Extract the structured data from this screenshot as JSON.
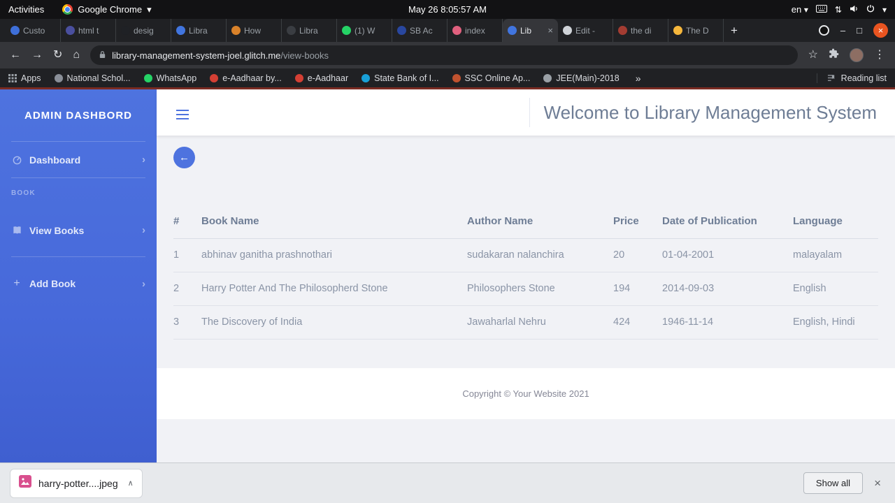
{
  "system_bar": {
    "activities_label": "Activities",
    "app_name": "Google Chrome",
    "clock": "May 26  8:05:57 AM",
    "language": "en"
  },
  "icons": {
    "caret_down": "▾",
    "caret_up": "∧",
    "back_arrow": "←",
    "forward_arrow": "→",
    "refresh": "↻",
    "home": "⌂",
    "star": "☆",
    "menu_dots": "⋮",
    "chevron_right": "›",
    "overflow_chevrons": "»",
    "close": "×",
    "plus": "+",
    "arrows_updown": "⇅",
    "minimize": "–",
    "maximize": "□"
  },
  "browser": {
    "tabs": [
      {
        "label": "Custo",
        "favicon_color": "#3e6fd9"
      },
      {
        "label": "html t",
        "favicon_color": "#4a4f9e"
      },
      {
        "label": "desig",
        "favicon_color": "#1f2125"
      },
      {
        "label": "Libra",
        "favicon_color": "#4175df"
      },
      {
        "label": "How",
        "favicon_color": "#d9822a"
      },
      {
        "label": "Libra",
        "favicon_color": "#3a3d42"
      },
      {
        "label": "(1) W",
        "favicon_color": "#25d366"
      },
      {
        "label": "SB Ac",
        "favicon_color": "#29479f"
      },
      {
        "label": "index",
        "favicon_color": "#e0607e"
      },
      {
        "label": "Lib",
        "favicon_color": "#4175df"
      },
      {
        "label": "Edit -",
        "favicon_color": "#cfd3d8"
      },
      {
        "label": "the di",
        "favicon_color": "#a33c32"
      },
      {
        "label": "The D",
        "favicon_color": "#f6b73c"
      }
    ],
    "address": {
      "domain": "library-management-system-joel.glitch.me",
      "path": "/view-books"
    },
    "bookmarks_bar": {
      "apps_label": "Apps",
      "items": [
        {
          "label": "National Schol...",
          "favicon_color": "#8a8f98"
        },
        {
          "label": "WhatsApp",
          "favicon_color": "#25d366"
        },
        {
          "label": "e-Aadhaar by...",
          "favicon_color": "#d43f34"
        },
        {
          "label": "e-Aadhaar",
          "favicon_color": "#d43f34"
        },
        {
          "label": "State Bank of I...",
          "favicon_color": "#18a0d8"
        },
        {
          "label": "SSC Online Ap...",
          "favicon_color": "#c0522f"
        },
        {
          "label": "JEE(Main)-2018",
          "favicon_color": "#9aa0a6"
        }
      ],
      "reading_list_label": "Reading list"
    }
  },
  "page": {
    "sidebar": {
      "brand": "ADMIN DASHBORD",
      "section_heading": "BOOK",
      "nav": [
        {
          "label": "Dashboard"
        },
        {
          "label": "View Books"
        },
        {
          "label": "Add Book"
        }
      ]
    },
    "topbar": {
      "welcome": "Welcome to Library Management System"
    },
    "books_table": {
      "headers": [
        "#",
        "Book Name",
        "Author Name",
        "Price",
        "Date of Publication",
        "Language"
      ],
      "rows": [
        {
          "num": "1",
          "name": "abhinav ganitha prashnothari",
          "author": "sudakaran nalanchira",
          "price": "20",
          "date": "01-04-2001",
          "language": "malayalam"
        },
        {
          "num": "2",
          "name": "Harry Potter And The Philosopherd Stone",
          "author": "Philosophers Stone",
          "price": "194",
          "date": "2014-09-03",
          "language": "English"
        },
        {
          "num": "3",
          "name": "The Discovery of India",
          "author": "Jawaharlal Nehru",
          "price": "424",
          "date": "1946-11-14",
          "language": "English, Hindi"
        }
      ]
    },
    "footer_text": "Copyright © Your Website 2021"
  },
  "download_shelf": {
    "filename": "harry-potter....jpeg",
    "show_all_label": "Show all"
  },
  "colors": {
    "accent_blue": "#4e73df",
    "ubuntu_close": "#e95420"
  }
}
